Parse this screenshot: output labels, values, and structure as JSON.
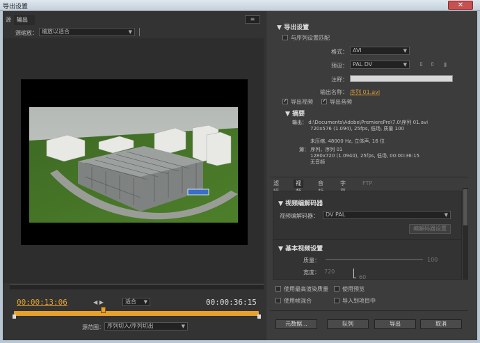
{
  "window": {
    "title": "导出设置",
    "close_glyph": "✕"
  },
  "left": {
    "tabs": [
      "源",
      "输出"
    ],
    "tab_menu_glyph": "≡",
    "zoom_label": "源缩放：",
    "zoom_value": "缩放以适合",
    "timecode_in": "00:00:13:06",
    "timecode_out": "00:00:36:15",
    "fit_value": "适合",
    "range_label": "源范围：",
    "range_value": "序列切入/序列切出"
  },
  "export": {
    "header": "导出设置",
    "match_sequence": "与序列设置匹配",
    "format_label": "格式：",
    "format_value": "AVI",
    "preset_label": "预设：",
    "preset_value": "PAL DV",
    "comment_label": "注释：",
    "output_name_label": "输出名称：",
    "output_name_value": "序列 01.avi",
    "export_video": "导出视频",
    "export_audio": "导出音频",
    "summary_header": "摘要",
    "output_label": "输出：",
    "output_line1": "d:\\Documents\\Adobe\\PremierePro\\7.0\\序列 01.avi",
    "output_line2": "720x576 (1.094), 25fps, 低场, 质量 100",
    "output_line3": "未压缩, 48000 Hz, 立体声, 16 位",
    "source_label": "源：",
    "source_line1": "序列，序列 01",
    "source_line2": "1280x720 (1.0940), 25fps, 低场, 00:00:36:15",
    "source_line3": "无音频"
  },
  "right_tabs": [
    "滤镜",
    "视频",
    "音频",
    "字幕",
    "FTP"
  ],
  "video": {
    "codec_header": "视频编解码器",
    "codec_label": "视频编解码器：",
    "codec_value": "DV PAL",
    "codec_settings_btn": "编解码器设置",
    "basic_header": "基本视频设置",
    "quality_label": "质量：",
    "quality_value": "100",
    "width_label": "宽度：",
    "width_value": "720",
    "height_value": "60"
  },
  "options": {
    "max_render": "使用最高渲染质量",
    "use_preview": "使用预览",
    "frame_blend": "使用帧混合",
    "import_project": "导入到项目中"
  },
  "buttons": {
    "metadata": "元数据...",
    "queue": "队列",
    "export": "导出",
    "cancel": "取消"
  },
  "colors": {
    "timecode_accent": "#e5a22a",
    "link": "#d79a36"
  }
}
